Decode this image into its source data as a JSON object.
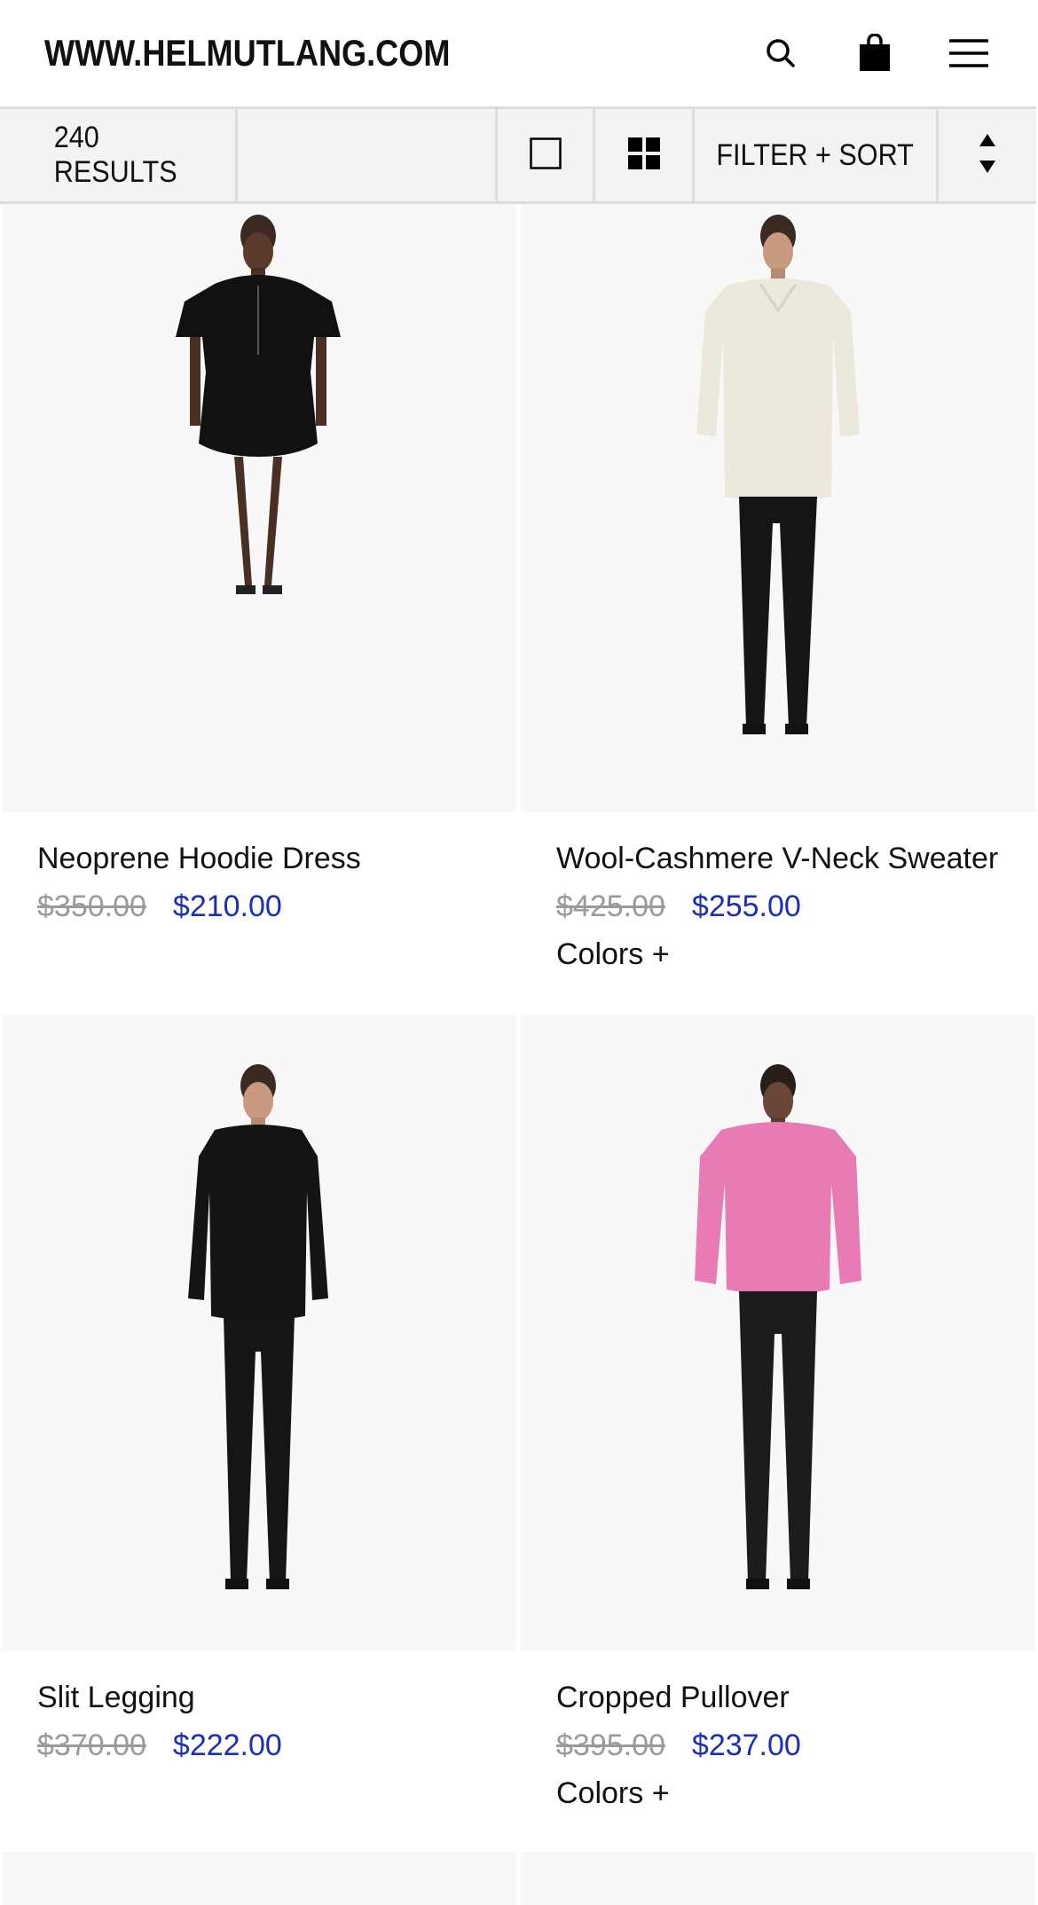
{
  "header": {
    "logo": "WWW.HELMUTLANG.COM",
    "icons": [
      "search-icon",
      "shopping-bag-icon",
      "hamburger-menu-icon"
    ]
  },
  "toolbar": {
    "results": "240 RESULTS",
    "filter_label": "FILTER + SORT",
    "view_icons": [
      "single-view-icon",
      "grid-view-icon"
    ],
    "sort_icon": "sort-arrows-icon"
  },
  "products": [
    {
      "name": "Neoprene Hoodie Dress",
      "old_price": "$350.00",
      "sale_price": "$210.00",
      "colors_label": "",
      "garment": "black-hooded-dress"
    },
    {
      "name": "Wool-Cashmere V-Neck Sweater",
      "old_price": "$425.00",
      "sale_price": "$255.00",
      "colors_label": "Colors +",
      "garment": "cream-sweater"
    },
    {
      "name": "Slit Legging",
      "old_price": "$370.00",
      "sale_price": "$222.00",
      "colors_label": "",
      "garment": "black-top-legging"
    },
    {
      "name": "Cropped Pullover",
      "old_price": "$395.00",
      "sale_price": "$237.00",
      "colors_label": "Colors +",
      "garment": "pink-pullover"
    }
  ],
  "colors": {
    "sale_price": "#1a2fb8",
    "old_price": "#9a9a9a",
    "toolbar_bg": "#f3f3f3",
    "photo_bg": "#f8f8f8"
  }
}
